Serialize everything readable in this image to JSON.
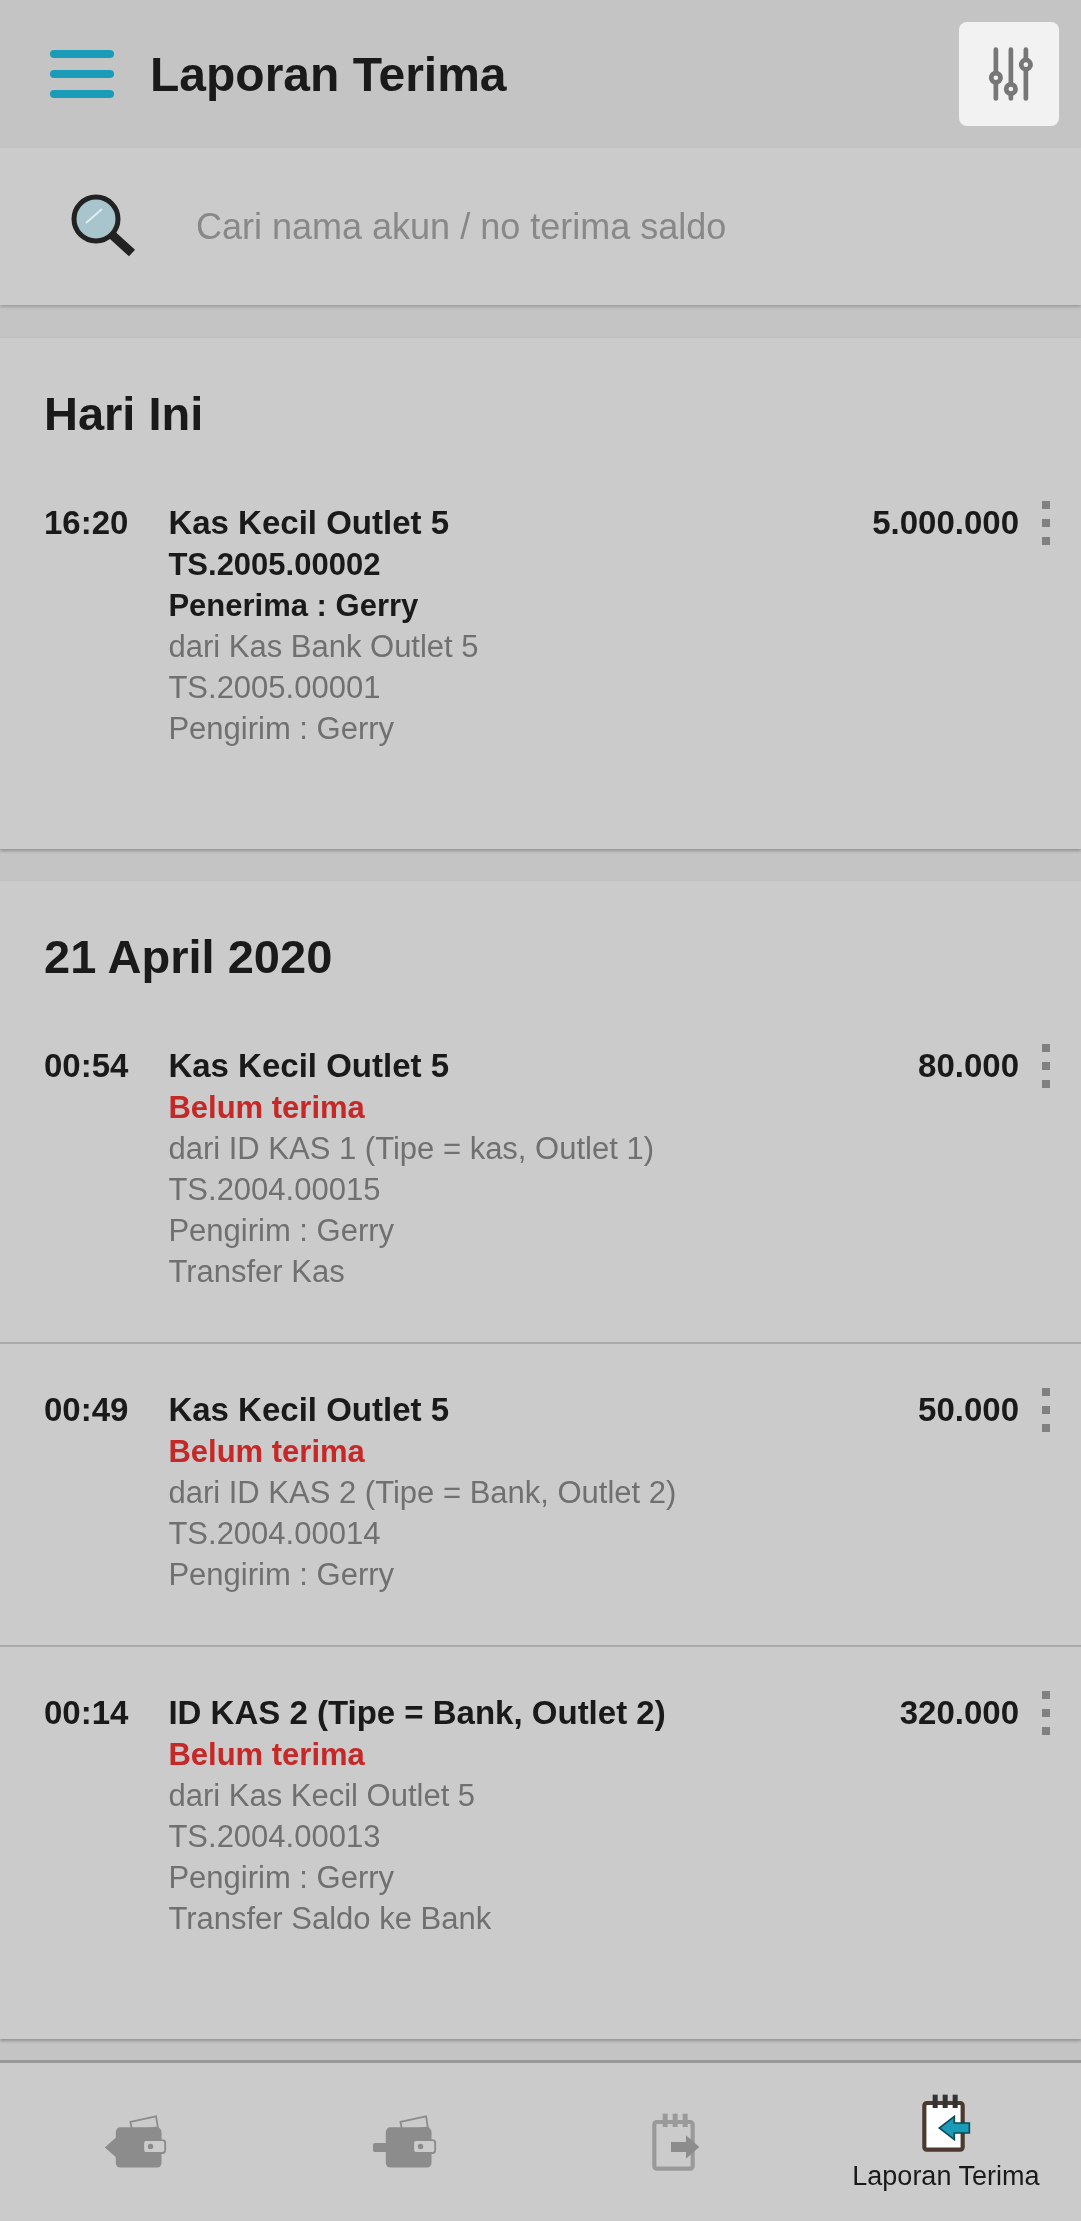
{
  "app_bar": {
    "title": "Laporan Terima"
  },
  "search": {
    "placeholder": "Cari nama akun / no terima saldo"
  },
  "sections": [
    {
      "heading": "Hari Ini",
      "entries": [
        {
          "time": "16:20",
          "title": "Kas Kecil Outlet 5",
          "amount": "5.000.000",
          "lines": [
            {
              "kind": "bold",
              "text": "TS.2005.00002"
            },
            {
              "kind": "bold",
              "text": "Penerima : Gerry"
            },
            {
              "kind": "plain",
              "text": "dari Kas Bank Outlet 5"
            },
            {
              "kind": "plain",
              "text": "TS.2005.00001"
            },
            {
              "kind": "plain",
              "text": "Pengirim : Gerry"
            }
          ]
        }
      ]
    },
    {
      "heading": "21 April 2020",
      "entries": [
        {
          "time": "00:54",
          "title": "Kas Kecil Outlet 5",
          "amount": "80.000",
          "lines": [
            {
              "kind": "status",
              "text": "Belum terima"
            },
            {
              "kind": "plain",
              "text": "dari ID KAS 1 (Tipe = kas, Outlet 1)"
            },
            {
              "kind": "plain",
              "text": "TS.2004.00015"
            },
            {
              "kind": "plain",
              "text": "Pengirim : Gerry"
            },
            {
              "kind": "plain",
              "text": "Transfer Kas"
            }
          ]
        },
        {
          "time": "00:49",
          "title": "Kas Kecil Outlet 5",
          "amount": "50.000",
          "lines": [
            {
              "kind": "status",
              "text": "Belum terima"
            },
            {
              "kind": "plain",
              "text": "dari ID KAS 2 (Tipe = Bank, Outlet 2)"
            },
            {
              "kind": "plain",
              "text": "TS.2004.00014"
            },
            {
              "kind": "plain",
              "text": "Pengirim : Gerry"
            }
          ]
        },
        {
          "time": "00:14",
          "title": "ID KAS 2 (Tipe = Bank, Outlet 2)",
          "amount": "320.000",
          "lines": [
            {
              "kind": "status",
              "text": "Belum terima"
            },
            {
              "kind": "plain",
              "text": "dari Kas Kecil Outlet 5"
            },
            {
              "kind": "plain",
              "text": "TS.2004.00013"
            },
            {
              "kind": "plain",
              "text": "Pengirim : Gerry"
            },
            {
              "kind": "plain",
              "text": "Transfer Saldo ke Bank"
            }
          ]
        }
      ]
    }
  ],
  "bottom_nav": [
    {
      "kind": "walletout",
      "selected": false
    },
    {
      "kind": "walletin",
      "selected": false
    },
    {
      "kind": "noteout",
      "selected": false
    },
    {
      "kind": "notein",
      "selected": true,
      "label": "Laporan Terima"
    }
  ]
}
